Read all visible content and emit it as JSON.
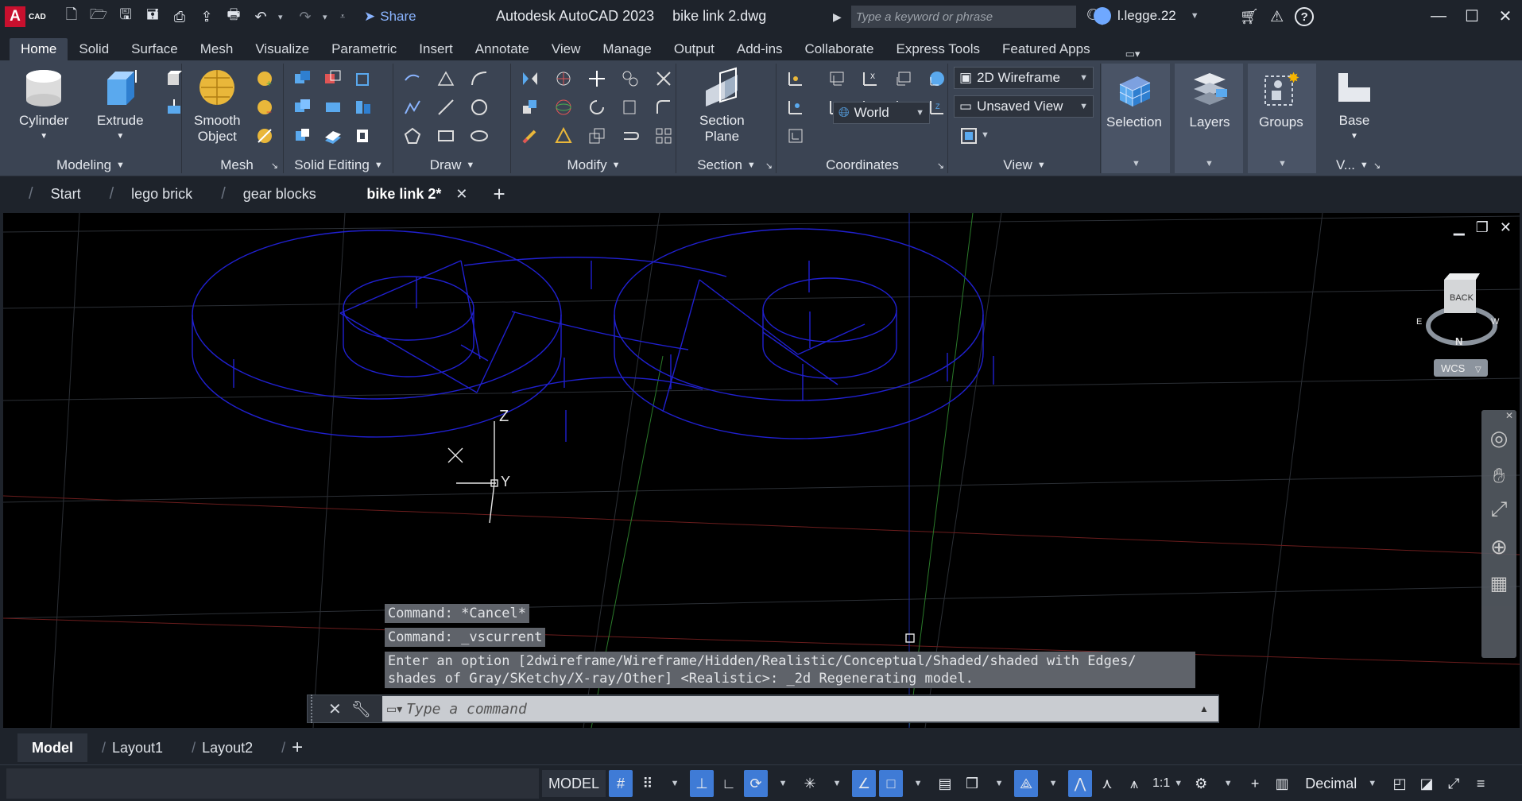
{
  "app": {
    "logo_letter": "A",
    "logo_sub": "CAD",
    "title": "Autodesk AutoCAD 2023",
    "file": "bike link 2.dwg",
    "share_label": "Share",
    "search_placeholder": "Type a keyword or phrase",
    "username": "l.legge.22"
  },
  "ribbon_tabs": [
    "Home",
    "Solid",
    "Surface",
    "Mesh",
    "Visualize",
    "Parametric",
    "Insert",
    "Annotate",
    "View",
    "Manage",
    "Output",
    "Add-ins",
    "Collaborate",
    "Express Tools",
    "Featured Apps"
  ],
  "active_tab": "Home",
  "panels": {
    "modeling": {
      "title": "Modeling",
      "cylinder": "Cylinder",
      "extrude": "Extrude"
    },
    "mesh": {
      "title": "Mesh",
      "smooth": "Smooth",
      "object": "Object"
    },
    "solid_editing": {
      "title": "Solid Editing"
    },
    "draw": {
      "title": "Draw"
    },
    "modify": {
      "title": "Modify"
    },
    "section": {
      "title": "Section",
      "btn_line1": "Section",
      "btn_line2": "Plane"
    },
    "coordinates": {
      "title": "Coordinates",
      "ucs_value": "World"
    },
    "view": {
      "title": "View",
      "visual_style": "2D Wireframe",
      "named_view": "Unsaved View"
    },
    "selection": {
      "title": "Selection"
    },
    "layers": {
      "title": "Layers"
    },
    "groups": {
      "title": "Groups"
    },
    "base": {
      "title": "V...",
      "btn": "Base"
    }
  },
  "doc_tabs": [
    {
      "label": "Start",
      "active": false
    },
    {
      "label": "lego brick",
      "active": false
    },
    {
      "label": "gear blocks",
      "active": false
    },
    {
      "label": "bike link 2*",
      "active": true
    }
  ],
  "viewcube": {
    "face": "BACK",
    "compass_n": "N",
    "compass_e": "E",
    "compass_w": "W",
    "wcs": "WCS"
  },
  "ucs_icon": {
    "x": "X",
    "y": "Y",
    "z": "Z"
  },
  "command_history": [
    "Command: *Cancel*",
    "Command: _vscurrent",
    "Enter an option [2dwireframe/Wireframe/Hidden/Realistic/Conceptual/Shaded/shaded with Edges/",
    "shades of Gray/SKetchy/X-ray/Other] <Realistic>: _2d Regenerating model."
  ],
  "command_placeholder": "Type a command",
  "layout_tabs": [
    {
      "label": "Model",
      "active": true
    },
    {
      "label": "Layout1",
      "active": false
    },
    {
      "label": "Layout2",
      "active": false
    }
  ],
  "status": {
    "model": "MODEL",
    "scale": "1:1",
    "units": "Decimal"
  },
  "colors": {
    "wire": "#1b1bd6",
    "accent": "#3f7bd6",
    "bg": "#1e232b",
    "ribbon": "#3b4453"
  }
}
